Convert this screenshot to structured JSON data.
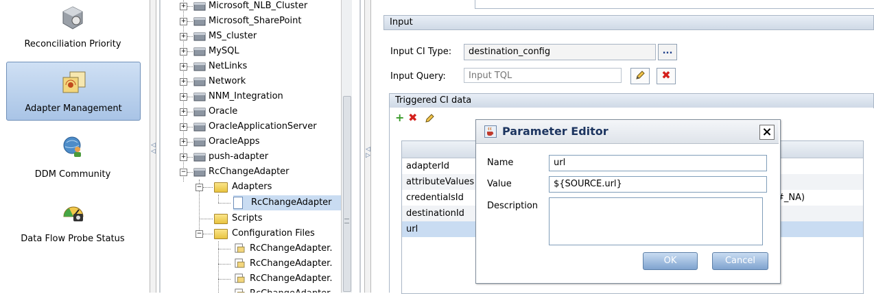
{
  "nav": {
    "items": [
      {
        "label": "Reconciliation Priority",
        "icon": "gear-wrench-icon"
      },
      {
        "label": "Adapter Management",
        "icon": "adapter-icon",
        "selected": true
      },
      {
        "label": "DDM Community",
        "icon": "community-globe-icon"
      },
      {
        "label": "Data Flow Probe Status",
        "icon": "gauge-camera-icon"
      }
    ]
  },
  "tree": {
    "items": [
      "Microsoft_NLB_Cluster",
      "Microsoft_SharePoint",
      "MS_cluster",
      "MySQL",
      "NetLinks",
      "Network",
      "NNM_Integration",
      "Oracle",
      "OracleApplicationServer",
      "OracleApps",
      "push-adapter",
      "RcChangeAdapter",
      "Adapters",
      "RcChangeAdapter",
      "Scripts",
      "Configuration Files",
      "RcChangeAdapter.",
      "RcChangeAdapter.",
      "RcChangeAdapter.",
      "RcChangeAdapter"
    ]
  },
  "input": {
    "header": "Input",
    "ci_type_label": "Input CI Type:",
    "ci_type_value": "destination_config",
    "browse_label": "...",
    "query_label": "Input Query:",
    "query_placeholder": "Input TQL"
  },
  "triggered": {
    "header": "Triggered CI data",
    "rows": [
      "adapterId",
      "attributeValues",
      "credentialsId",
      "destinationId",
      "url"
    ],
    "partial_value": "#_NA)"
  },
  "dialog": {
    "title": "Parameter Editor",
    "close": "×",
    "name_label": "Name",
    "name_value": "url",
    "value_label": "Value",
    "value_value": "${SOURCE.url}",
    "description_label": "Description",
    "description_value": "",
    "ok": "OK",
    "cancel": "Cancel"
  },
  "colors": {
    "accent": "#a9c4e6",
    "selected_row": "#c9dcf2",
    "delete_red": "#d4201c",
    "add_green": "#3a9a2a"
  }
}
